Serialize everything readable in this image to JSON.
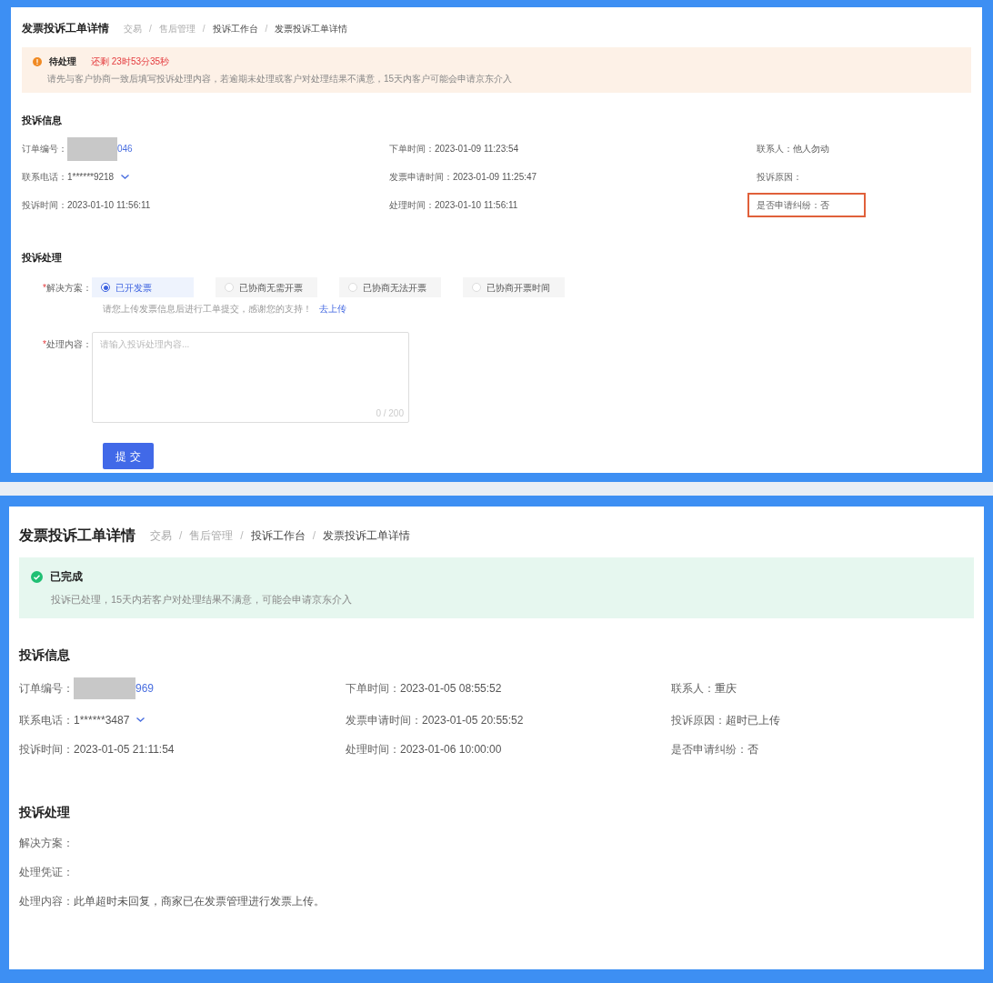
{
  "panels": [
    {
      "title": "发票投诉工单详情",
      "breadcrumb": [
        {
          "label": "交易",
          "current": false
        },
        {
          "label": "售后管理",
          "current": false
        },
        {
          "label": "投诉工作台",
          "current": true
        },
        {
          "label": "发票投诉工单详情",
          "current": true
        }
      ],
      "separator": "/",
      "status": {
        "kind": "pending",
        "label": "待处理",
        "countdown": "还剩 23时53分35秒",
        "message": "请先与客户协商一致后填写投诉处理内容，若逾期未处理或客户对处理结果不满意，15天内客户可能会申请京东介入"
      },
      "info": {
        "heading": "投诉信息",
        "fields": [
          {
            "kind": "order",
            "label": "订单编号：",
            "value": "046",
            "highlighted": false
          },
          {
            "kind": "text",
            "label": "下单时间：",
            "value": "2023-01-09 11:23:54",
            "highlighted": false
          },
          {
            "kind": "text",
            "label": "联系人：",
            "value": "他人勿动",
            "highlighted": false
          },
          {
            "kind": "phone",
            "label": "联系电话：",
            "value": "1******9218",
            "highlighted": false
          },
          {
            "kind": "text",
            "label": "发票申请时间：",
            "value": "2023-01-09 11:25:47",
            "highlighted": false
          },
          {
            "kind": "text",
            "label": "投诉原因：",
            "highlighted": false
          },
          {
            "kind": "text",
            "label": "投诉时间：",
            "value": "2023-01-10 11:56:11",
            "highlighted": false
          },
          {
            "kind": "text",
            "label": "处理时间：",
            "value": "2023-01-10 11:56:11",
            "highlighted": false
          },
          {
            "kind": "text",
            "label": "是否申请纠纷：",
            "value": "否",
            "highlighted": true
          }
        ]
      },
      "handling": {
        "kind": "form",
        "heading": "投诉处理",
        "solution": {
          "mark": "*",
          "label": "解决方案：",
          "options": [
            {
              "label": "已开发票",
              "selected": true
            },
            {
              "label": "已协商无需开票",
              "selected": false
            },
            {
              "label": "已协商无法开票",
              "selected": false
            },
            {
              "label": "已协商开票时间",
              "selected": false
            }
          ],
          "hint": "请您上传发票信息后进行工单提交，感谢您的支持！",
          "link": "去上传"
        },
        "content": {
          "mark": "*",
          "label": "处理内容：",
          "placeholder": "请输入投诉处理内容...",
          "counter": "0 / 200"
        },
        "submit": "提 交"
      }
    },
    {
      "title": "发票投诉工单详情",
      "breadcrumb": [
        {
          "label": "交易",
          "current": false
        },
        {
          "label": "售后管理",
          "current": false
        },
        {
          "label": "投诉工作台",
          "current": true
        },
        {
          "label": "发票投诉工单详情",
          "current": true
        }
      ],
      "separator": "/",
      "status": {
        "kind": "done",
        "label": "已完成",
        "message": "投诉已处理，15天内若客户对处理结果不满意，可能会申请京东介入"
      },
      "info": {
        "heading": "投诉信息",
        "fields": [
          {
            "kind": "order",
            "label": "订单编号：",
            "value": "969",
            "highlighted": false
          },
          {
            "kind": "text",
            "label": "下单时间：",
            "value": "2023-01-05 08:55:52",
            "highlighted": false
          },
          {
            "kind": "text",
            "label": "联系人：",
            "value": "重庆",
            "highlighted": false
          },
          {
            "kind": "phone",
            "label": "联系电话：",
            "value": "1******3487",
            "highlighted": false
          },
          {
            "kind": "text",
            "label": "发票申请时间：",
            "value": "2023-01-05 20:55:52",
            "highlighted": false
          },
          {
            "kind": "text",
            "label": "投诉原因：",
            "value": "超时已上传",
            "highlighted": false
          },
          {
            "kind": "text",
            "label": "投诉时间：",
            "value": "2023-01-05 21:11:54",
            "highlighted": false
          },
          {
            "kind": "text",
            "label": "处理时间：",
            "value": "2023-01-06 10:00:00",
            "highlighted": false
          },
          {
            "kind": "text",
            "label": "是否申请纠纷：",
            "value": "否",
            "highlighted": false
          }
        ]
      },
      "handling": {
        "kind": "readonly",
        "heading": "投诉处理",
        "rows": [
          {
            "label": "解决方案："
          },
          {
            "label": "处理凭证："
          },
          {
            "label": "处理内容：",
            "value": "此单超时未回复，商家已在发票管理进行发票上传。"
          }
        ]
      }
    }
  ]
}
